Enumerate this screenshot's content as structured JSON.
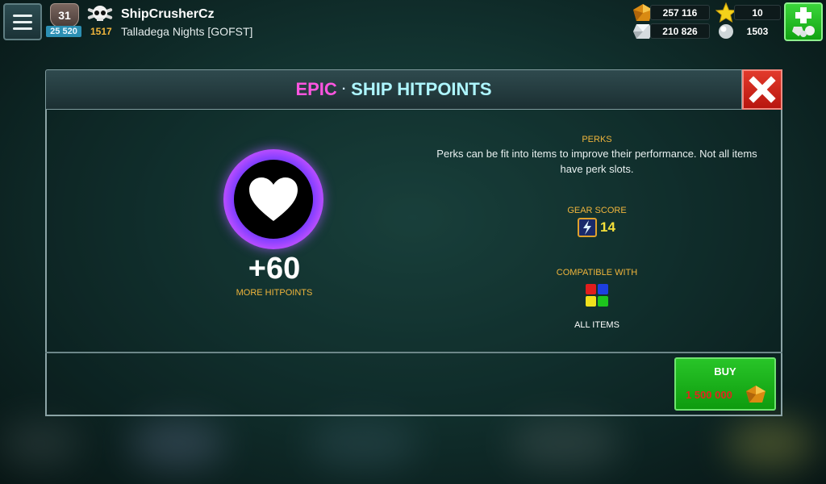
{
  "hud": {
    "player_level": "31",
    "xp_points": "25 520",
    "rank_score": "1517",
    "player_name": "ShipCrusherCz",
    "guild_name": "Talladega Nights [GOFST]",
    "resources": {
      "gold": "257 116",
      "silver": "210 826",
      "stars": "10",
      "pearls": "1503"
    }
  },
  "dialog": {
    "rarity": "EPIC",
    "separator": "·",
    "title": "SHIP HITPOINTS",
    "perk_value": "+60",
    "perk_stat_label": "MORE HITPOINTS",
    "perks_label": "PERKS",
    "perks_description": "Perks can be fit into items to improve their performance. Not all items have perk slots.",
    "gear_score_label": "GEAR SCORE",
    "gear_score": "14",
    "compatible_label": "COMPATIBLE WITH",
    "compatible_value": "ALL ITEMS",
    "buy_label": "BUY",
    "price": "1 500 000"
  },
  "colors": {
    "rarity": "#ff55e0",
    "title": "#aef6ff",
    "label_orange": "#f0b53c",
    "price_red": "#e2261d",
    "buy_green": "#1fb51f",
    "close_red": "#d3251a",
    "compat": [
      "#e11d1d",
      "#1d3fe1",
      "#f0e01d",
      "#1dc41d"
    ]
  },
  "icons": {
    "menu": "hamburger-icon",
    "level": "level-shield-icon",
    "rank": "skull-icon",
    "gold": "gold-gem-icon",
    "silver": "silver-gem-icon",
    "stars": "star-icon",
    "pearls": "pearl-icon",
    "add": "add-resources-icon",
    "close": "close-icon",
    "perk": "heart-icon",
    "gear_score": "gear-score-icon",
    "compatible": "color-grid-icon"
  }
}
